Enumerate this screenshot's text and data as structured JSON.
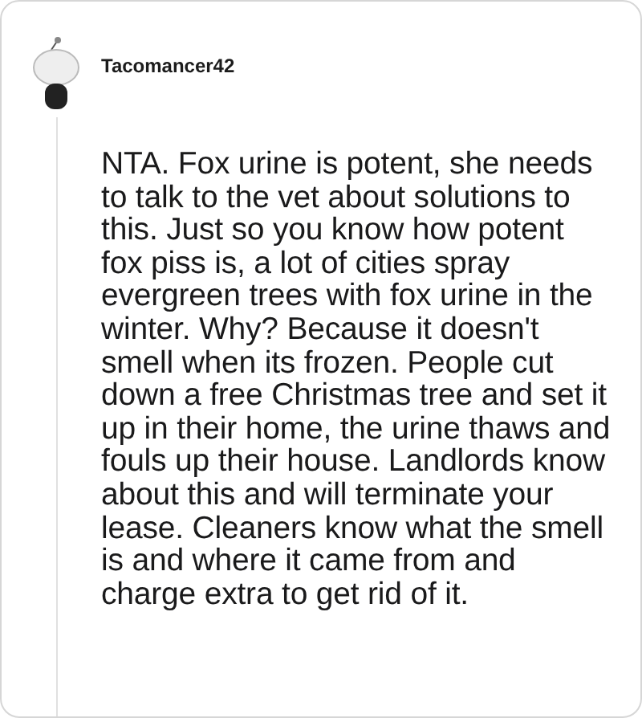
{
  "comment": {
    "author": "Tacomancer42",
    "body": "NTA. Fox urine is potent, she needs to talk to the vet about solutions to this. Just so you know how potent fox piss is, a lot of cities spray evergreen trees with fox urine in the winter. Why? Because it doesn't smell when its frozen. People cut down a free Christmas tree and set it up in their home, the urine thaws and fouls up their house. Landlords know about this and will terminate your lease. Cleaners know what the smell is and where it came from and charge extra to get rid of it."
  }
}
